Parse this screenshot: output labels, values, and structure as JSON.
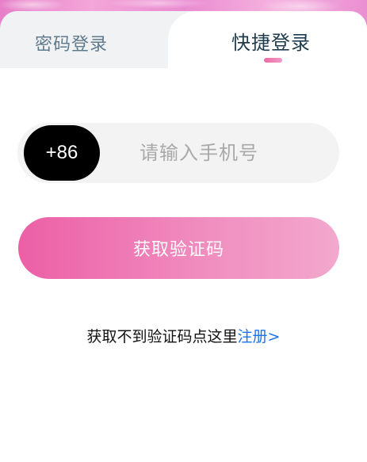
{
  "tabs": {
    "password_login": "密码登录",
    "quick_login": "快捷登录"
  },
  "phone": {
    "country_code": "+86",
    "placeholder": "请输入手机号",
    "value": ""
  },
  "actions": {
    "get_code_label": "获取验证码"
  },
  "help": {
    "prompt": "获取不到验证码点这里",
    "register_link": "注册>"
  },
  "colors": {
    "accent_pink": "#ec5fa6",
    "link_blue": "#1a73e8",
    "country_code_bg": "#000000"
  }
}
